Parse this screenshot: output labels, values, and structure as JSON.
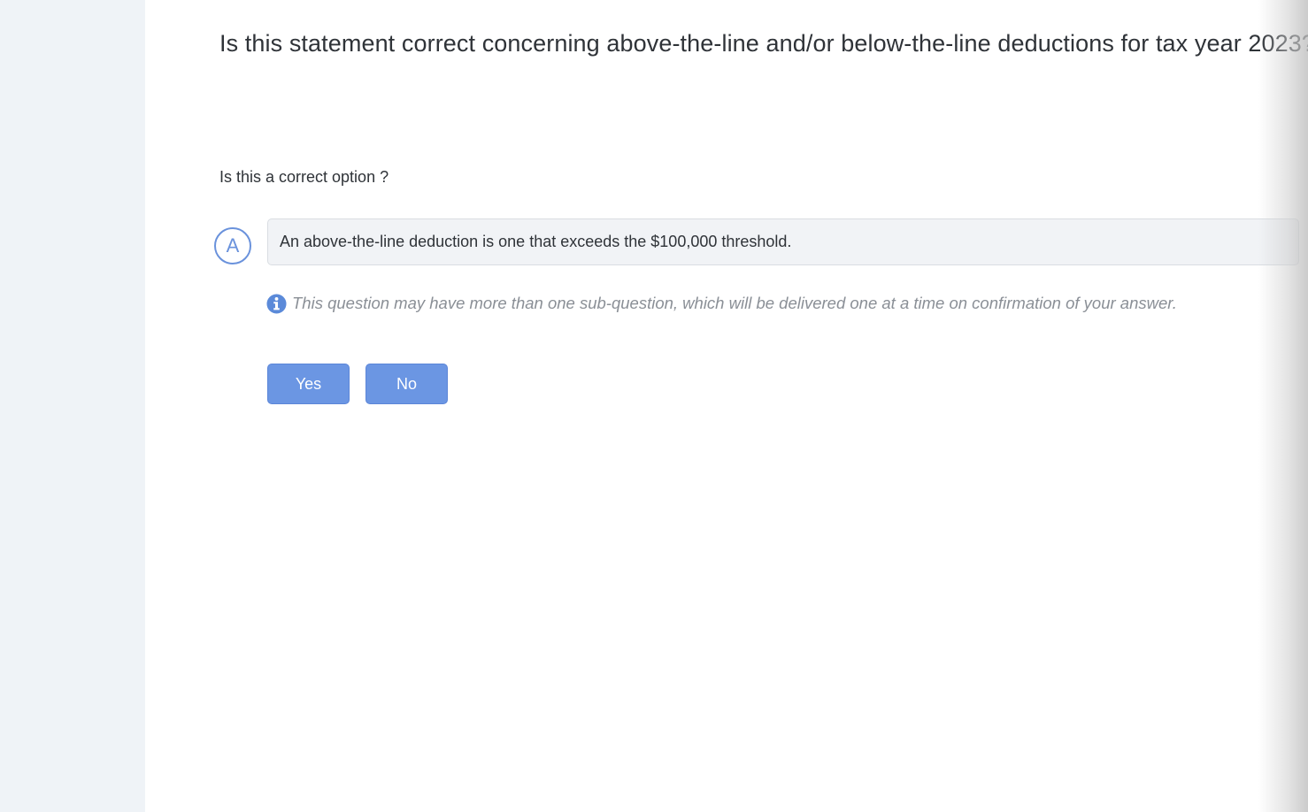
{
  "question": {
    "title": "Is this statement correct concerning above-the-line and/or below-the-line deductions for tax year 2023?",
    "prompt": "Is this a correct option ?"
  },
  "option": {
    "letter": "A",
    "text": "An above-the-line deduction is one that exceeds the $100,000 threshold."
  },
  "info": {
    "icon": "info-circle-icon",
    "text": "This question may have more than one sub-question, which will be delivered one at a time on confirmation of your answer."
  },
  "actions": {
    "yes_label": "Yes",
    "no_label": "No"
  },
  "colors": {
    "accent": "#6b96e3",
    "sidebar_bg": "#eff3f7",
    "option_bg": "#f1f3f6"
  }
}
